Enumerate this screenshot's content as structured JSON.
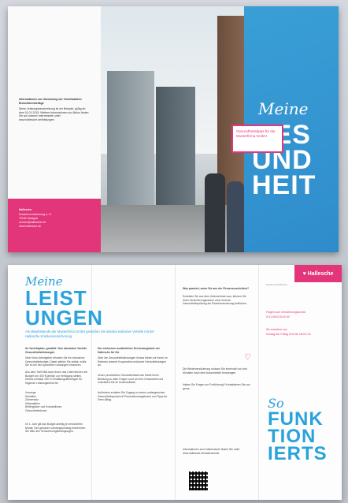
{
  "top_spread": {
    "left_page": {
      "info_heading": "Informationen zur Umsetzung der Vorteilsaktion Broschürenbeilage",
      "info_body": "Diese Leistungsbeschreibung ist ein Beispiel, gültig ab dem 01.01.2015. Weitere Informationen zur Aktion finden Sie auf unserer Internetseite unter www.hallesche.de/leistungen",
      "contact_lines": [
        "Hallesche",
        "Krankenversicherung a. G.",
        "70166 Stuttgart",
        "service@hallesche.de",
        "www.hallesche.de"
      ]
    },
    "photo_sign": "Gesundheitstipps für die Musterfirma GmbH",
    "cover_script": "Meine",
    "cover_big": [
      "GES",
      "UND",
      "HEIT"
    ]
  },
  "bottom_spread": {
    "left_col": {
      "script": "Meine",
      "big": [
        "LEIST",
        "UNGEN"
      ],
      "intro": "Als Mitarbeitende der Musterfirma GmbH genießen Sie absolut exklusive Vorteile mit der Hallesche Krankenversicherung.",
      "subhead_1": "Ihr Vorteilsplan: gewählt / Ihre absoluten Vorteile Gesundheitsleistungen",
      "body_1": "Über Ihren Arbeitgeber erhalten Sie ein exklusives Gesundheitsbudget. Dabei wählen Sie selbst, wofür Sie es bei den speziellen Leistungen einsetzen.",
      "body_2": "Aus dem Tarif KBA kann Ihnen das Unternehmen ein Budget von 300 € jährlich zur Verfügung stellen. Dieses umfasst 100 % Erstattungsleistungen für folgende Leistungsbereiche:",
      "list": [
        "Vorsorge",
        "Sehhilfen",
        "Zahnersatz",
        "Heilpraktiker",
        "Brillengläser und Kontaktlinsen",
        "Gesundheitskurse"
      ],
      "footer": "Im 1. Jahr gilt das Budget anteilig je versicherten Monat. Den genauen Leistungsumfang entnehmen Sie bitte den Versicherungsbedingungen."
    },
    "mid_left_col": {
      "heading": "Die exklusiven zusätzlichen Serviceangebote der Hallesche für Sie",
      "body_1": "Über die Gesundheitsleistungen hinaus bieten wir Ihnen im Rahmen unserer Kooperation exklusive Serviceleistungen an.",
      "body_2": "Unser persönlicher Gesundheitsservice bietet Ihnen Beratung zu allen Fragen rund um Ihre Gesundheit und unterstützt Sie im Krankheitsfall.",
      "body_3": "Außerdem erhalten Sie Zugang zu einem umfangreichen Gesundheitsportal mit Präventionsangeboten und Tipps für Ihren Alltag."
    },
    "mid_right_col": {
      "heading": "Was passiert, wenn Sie aus der Firma ausscheiden?",
      "body_1": "Scheiden Sie aus dem Unternehmen aus, können Sie Ihren Versicherungsschutz ohne erneute Gesundheitsprüfung als Einzelversicherung fortführen.",
      "body_2": "Die Weiterversicherung müssen Sie innerhalb von drei Monaten nach dem Ausscheiden beantragen.",
      "body_3": "Haben Sie Fragen zur Fortführung? Kontaktieren Sie uns gerne.",
      "footer": "Informationen zum Datenschutz finden Sie unter www.hallesche.de/datenschutz"
    },
    "right_col": {
      "logo": "Hallesche",
      "logo_sub": "Krankenversicherung",
      "contact_1": "Fragen zum Versicherungsschutz",
      "contact_1_detail": "0711 6603 62 60 60",
      "contact_2": "Sie erreichen uns",
      "contact_2_detail": "Montag bis Freitag 8:00 bis 18:00 Uhr",
      "script": "So",
      "big": [
        "FUNK",
        "TION",
        "IERTS"
      ]
    }
  },
  "colors": {
    "pink": "#e2357a",
    "blue": "#2aa2db",
    "cover_blue": "#3a9fd6"
  }
}
